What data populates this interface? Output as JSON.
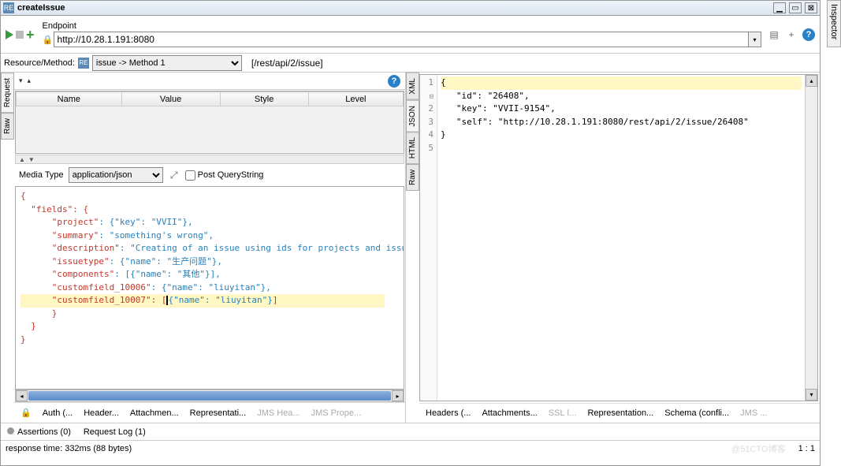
{
  "titlebar": {
    "title": "createIssue"
  },
  "inspector_tab": "Inspector",
  "endpoint": {
    "label": "Endpoint",
    "url": "http://10.28.1.191:8080"
  },
  "resource": {
    "label": "Resource/Method:",
    "selected": "issue -> Method 1",
    "path": "[/rest/api/2/issue]"
  },
  "params_table": {
    "cols": [
      "Name",
      "Value",
      "Style",
      "Level"
    ]
  },
  "left_vtabs": {
    "request": "Request",
    "raw": "Raw"
  },
  "mediatype": {
    "label": "Media Type",
    "value": "application/json",
    "post_qs": "Post QueryString"
  },
  "request_body": {
    "l1": "{",
    "l2_k": "\"fields\"",
    "l2_r": ": {",
    "l3_k": "\"project\"",
    "l3_v": ": {\"key\": \"VVII\"},",
    "l4_k": "\"summary\"",
    "l4_v": ": \"something's wrong\",",
    "l5_k": "\"description\"",
    "l5_v": ": \"Creating of an issue using ids for projects and issue types using the REST API\",",
    "l6_k": "\"issuetype\"",
    "l6_v": ": {\"name\": \"生产问题\"},",
    "l7_k": "\"components\"",
    "l7_v": ": [{\"name\": \"其他\"}],",
    "l8_k": "\"customfield_10006\"",
    "l8_v": ": {\"name\": \"liuyitan\"},",
    "l9_k": "\"customfield_10007\"",
    "l9_v1": ": [",
    "l9_v2": "{\"name\": \"liuyitan\"}",
    "l9_v3": "]",
    "l10": "}",
    "l11": "}",
    "l12": "}"
  },
  "left_tabs": {
    "auth": "Auth (...",
    "headers": "Header...",
    "attach": "Attachmen...",
    "repr": "Representati...",
    "jmsh": "JMS Hea...",
    "jmsp": "JMS Prope..."
  },
  "right_vtabs": {
    "xml": "XML",
    "json": "JSON",
    "html": "HTML",
    "raw": "Raw"
  },
  "response": {
    "gutter": [
      "1",
      "2",
      "3",
      "4",
      "5"
    ],
    "l1": "{",
    "l2_k": "\"id\"",
    "l2_v": ": \"26408\",",
    "l3_k": "\"key\"",
    "l3_v": ": \"VVII-9154\",",
    "l4_k": "\"self\"",
    "l4_v": ": \"http://10.28.1.191:8080/rest/api/2/issue/26408\"",
    "l5": "}"
  },
  "right_tabs": {
    "headers": "Headers (...",
    "attach": "Attachments...",
    "ssl": "SSL I...",
    "repr": "Representation...",
    "schema": "Schema (confli...",
    "jms": "JMS ..."
  },
  "footer1": {
    "assertions": "Assertions (0)",
    "reqlog": "Request Log (1)"
  },
  "footer2": {
    "status": "response time: 332ms (88 bytes)",
    "pos": "1 : 1",
    "watermark": "@51CTO博客"
  }
}
